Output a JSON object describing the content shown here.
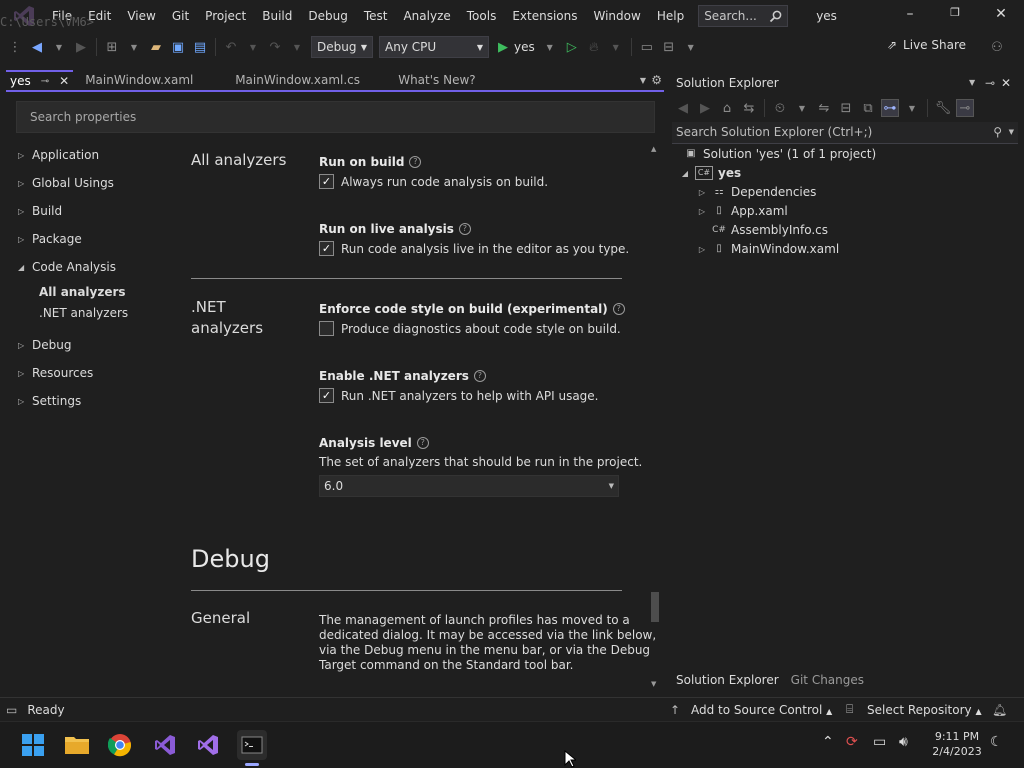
{
  "titlebar": {
    "cwd": "C:\\Users\\VM6>",
    "menu": [
      "File",
      "Edit",
      "View",
      "Git",
      "Project",
      "Build",
      "Debug",
      "Test",
      "Analyze",
      "Tools",
      "Extensions",
      "Window",
      "Help"
    ],
    "search_placeholder": "Search...",
    "solution_name": "yes"
  },
  "toolbar": {
    "config": "Debug",
    "platform": "Any CPU",
    "run_target": "yes",
    "live_share": "Live Share"
  },
  "tabs": [
    {
      "label": "yes",
      "active": true
    },
    {
      "label": "MainWindow.xaml"
    },
    {
      "label": "MainWindow.xaml.cs"
    },
    {
      "label": "What's New?"
    }
  ],
  "properties": {
    "search_placeholder": "Search properties",
    "nav": [
      {
        "label": "Application"
      },
      {
        "label": "Global Usings"
      },
      {
        "label": "Build"
      },
      {
        "label": "Package"
      },
      {
        "label": "Code Analysis",
        "expanded": true
      },
      {
        "label": "Debug"
      },
      {
        "label": "Resources"
      },
      {
        "label": "Settings"
      }
    ],
    "nav_sub": [
      "All analyzers",
      ".NET analyzers"
    ],
    "sections": {
      "all_analyzers": "All analyzers",
      "net_analyzers_line1": ".NET",
      "net_analyzers_line2": "analyzers",
      "debug": "Debug",
      "general": "General"
    },
    "run_on_build": {
      "label": "Run on build",
      "desc": "Always run code analysis on build.",
      "checked": true
    },
    "run_on_live": {
      "label": "Run on live analysis",
      "desc": "Run code analysis live in the editor as you type.",
      "checked": true
    },
    "enforce_style": {
      "label": "Enforce code style on build (experimental)",
      "desc": "Produce diagnostics about code style on build.",
      "checked": false
    },
    "enable_net": {
      "label": "Enable .NET analyzers",
      "desc": "Run .NET analyzers to help with API usage.",
      "checked": true
    },
    "analysis_level": {
      "label": "Analysis level",
      "desc": "The set of analyzers that should be run in the project.",
      "value": "6.0"
    },
    "general_text": [
      "The management of launch profiles has moved to a",
      "dedicated dialog. It may be accessed via the link below,",
      "via the Debug menu in the menu bar, or via the Debug",
      "Target command on the Standard tool bar."
    ]
  },
  "solution_explorer": {
    "title": "Solution Explorer",
    "search_placeholder": "Search Solution Explorer (Ctrl+;)",
    "solution": "Solution 'yes' (1 of 1 project)",
    "project": "yes",
    "items": [
      {
        "label": "Dependencies",
        "icon": "dependencies-icon"
      },
      {
        "label": "App.xaml",
        "icon": "xaml-file-icon"
      },
      {
        "label": "AssemblyInfo.cs",
        "icon": "csharp-file-icon"
      },
      {
        "label": "MainWindow.xaml",
        "icon": "xaml-file-icon"
      }
    ],
    "bottom_tabs": [
      "Solution Explorer",
      "Git Changes"
    ]
  },
  "status": {
    "ready": "Ready",
    "add_source": "Add to Source Control",
    "select_repo": "Select Repository"
  },
  "taskbar": {
    "time": "9:11 PM",
    "date": "2/4/2023"
  },
  "colors": {
    "accent": "#7160e8",
    "background": "#1f1f1f",
    "run_green": "#3ebd5e"
  }
}
